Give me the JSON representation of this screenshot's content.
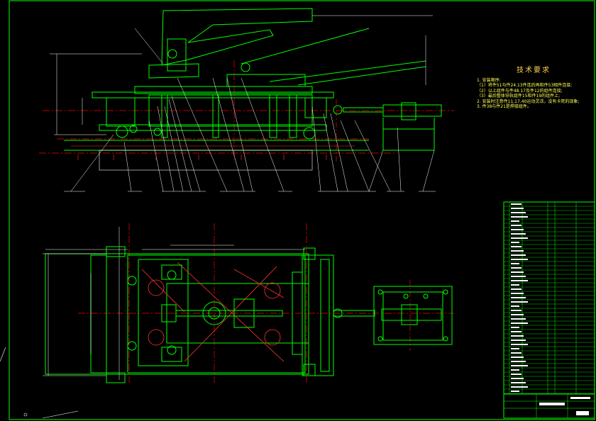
{
  "technical_requirements": {
    "title": "技术要求",
    "lines": [
      "1. 安装顺序:",
      "（1）将件51与件24.13件连后再和件53相件连接;",
      "（2）以上组件与件48.17及件12的组件连接;",
      "（3）最后整体导轨组件15和件19的组件上;",
      "2. 安装时注意件11.17.40运动灵活，没有卡死的现象;",
      "3. 件38与件21是焊接组件。"
    ]
  },
  "colors": {
    "background": "#000000",
    "outline": "#00ff00",
    "centerline": "#ff0000",
    "dimension": "#ffffff",
    "annotation": "#ffff55",
    "hatch": "#ff3333",
    "frame": "#00ff00"
  }
}
